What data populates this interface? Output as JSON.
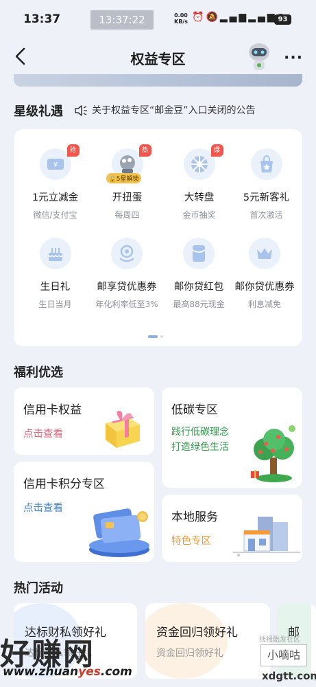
{
  "status_bar": {
    "time": "13:37",
    "clock_overlay": "13:37:22",
    "net_speed_value": "0.00",
    "net_speed_unit": "KB/s",
    "icons": [
      "alarm-icon",
      "mute-icon",
      "signal-5g-icon",
      "signal-5g-icon",
      "wifi-icon"
    ],
    "battery": "93"
  },
  "header": {
    "title": "权益专区"
  },
  "star_perks": {
    "title": "星级礼遇",
    "notice": "关于权益专区“邮金豆”入口关闭的公告",
    "items": [
      {
        "name": "1元立减金",
        "sub": "微信/支付宝",
        "tag": "抢",
        "icon": "coupon-icon"
      },
      {
        "name": "开扭蛋",
        "sub": "每周四",
        "tag": "热",
        "lock": "5星解锁",
        "icon": "capsule-icon"
      },
      {
        "name": "大转盘",
        "sub": "金币抽奖",
        "tag": "爆",
        "icon": "wheel-icon"
      },
      {
        "name": "5元新客礼",
        "sub": "首次激活",
        "icon": "gift-bag-icon"
      },
      {
        "name": "生日礼",
        "sub": "生日当月",
        "icon": "cake-icon"
      },
      {
        "name": "邮享贷优惠券",
        "sub": "年化利率低至3%",
        "icon": "loan-icon"
      },
      {
        "name": "邮你贷红包",
        "sub": "最高88元现金",
        "icon": "red-packet-icon"
      },
      {
        "name": "邮你贷优惠券",
        "sub": "利息减免",
        "icon": "crown-icon"
      }
    ]
  },
  "welfare": {
    "title": "福利优选",
    "credit_card": {
      "title": "信用卡权益",
      "link": "点击查看"
    },
    "credit_points": {
      "title": "信用卡积分专区",
      "link": "点击查看"
    },
    "low_carbon": {
      "title": "低碳专区",
      "line1": "践行低碳理念",
      "line2": "打造绿色生活"
    },
    "local": {
      "title": "本地服务",
      "link": "特色专区"
    }
  },
  "hot": {
    "title": "热门活动",
    "cards": [
      {
        "title": "达标财私领好礼",
        "sub": "达标财私领好礼"
      },
      {
        "title": "资金回归领好礼",
        "sub": "资金回归领好礼"
      },
      {
        "title": "邮"
      }
    ]
  },
  "watermark": {
    "main": "好赚网",
    "url_a": "www.zhuan",
    "url_b": "yes",
    "url_c": ".com",
    "right_small": "线报酷发社区",
    "right_box": "小嘀咕",
    "right_url": "xdgtt.com"
  },
  "colors": {
    "link_pink": "#e8637a",
    "link_blue": "#3f7fd4",
    "green": "#2e9a4a",
    "orange": "#f09a2e",
    "tag_red": "#f0564b"
  }
}
